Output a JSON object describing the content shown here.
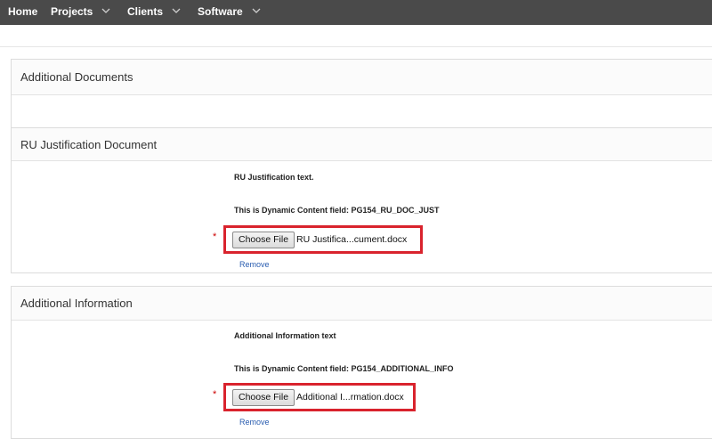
{
  "nav": {
    "home": "Home",
    "projects": "Projects",
    "clients": "Clients",
    "software": "Software"
  },
  "sections": {
    "additional_documents": {
      "title": "Additional Documents"
    },
    "ru_justification": {
      "title": "RU Justification Document",
      "text": "RU Justification text.",
      "dynamic_text": "This is Dynamic Content field: PG154_RU_DOC_JUST",
      "required_marker": "*",
      "choose_file_label": "Choose File",
      "file_name": "RU Justifica...cument.docx",
      "remove_label": "Remove"
    },
    "additional_info": {
      "title": "Additional Information",
      "text": "Additional Information text",
      "dynamic_text": "This is Dynamic Content field: PG154_ADDITIONAL_INFO",
      "required_marker": "*",
      "choose_file_label": "Choose File",
      "file_name": "Additional I...rmation.docx",
      "remove_label": "Remove"
    }
  },
  "colors": {
    "nav_bg": "#4a4a4a",
    "highlight_border": "#d9232d",
    "link": "#2a5db0",
    "required": "#cc0000"
  }
}
